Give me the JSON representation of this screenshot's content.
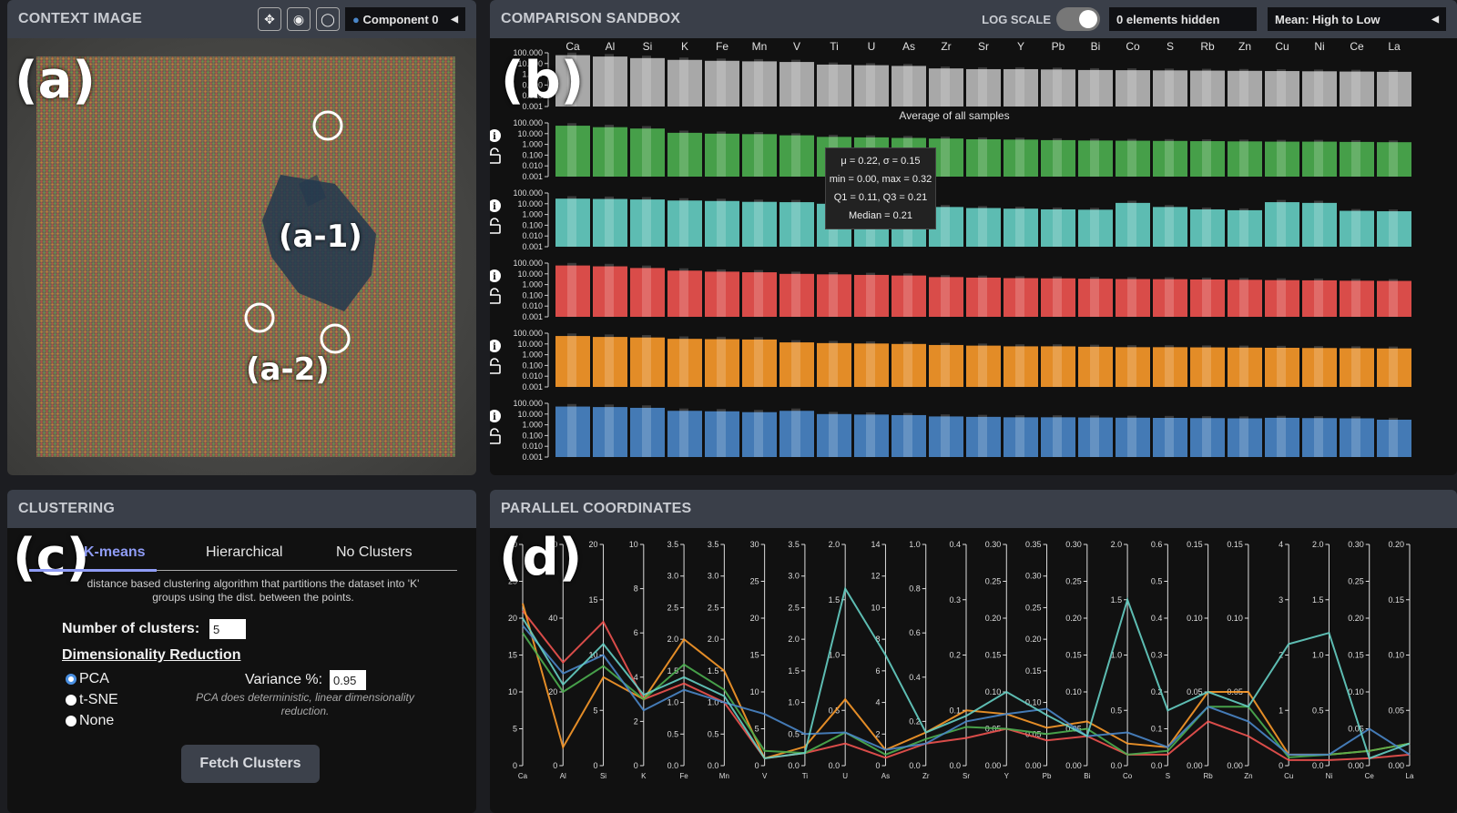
{
  "panel_labels": {
    "a": "(a)",
    "a1": "(a-1)",
    "a2": "(a-2)",
    "b": "(b)",
    "c": "(c)",
    "d": "(d)"
  },
  "context": {
    "title": "CONTEXT IMAGE",
    "buttons": [
      {
        "icon": "lasso-move-icon"
      },
      {
        "icon": "eye-icon"
      },
      {
        "icon": "lasso-icon"
      }
    ],
    "component_select": "Component 0"
  },
  "sandbox": {
    "title": "COMPARISON SANDBOX",
    "log_scale_label": "LOG SCALE",
    "hidden_text": "0 elements hidden",
    "sort_select": "Mean: High to Low",
    "elements": [
      "Ca",
      "Al",
      "Si",
      "K",
      "Fe",
      "Mn",
      "V",
      "Ti",
      "U",
      "As",
      "Zr",
      "Sr",
      "Y",
      "Pb",
      "Bi",
      "Co",
      "S",
      "Rb",
      "Zn",
      "Cu",
      "Ni",
      "Ce",
      "La"
    ],
    "y_ticks": [
      "100.000",
      "10.000",
      "1.000",
      "0.100",
      "0.010",
      "0.001"
    ],
    "average_caption": "Average of all samples",
    "tooltip": [
      "μ = 0.22, σ = 0.15",
      "min = 0.00, max = 0.32",
      "Q1 = 0.11, Q3 = 0.21",
      "Median = 0.21"
    ],
    "rows": [
      {
        "color": "#b9b9b9",
        "values": [
          60,
          45,
          32,
          22,
          18,
          16,
          14,
          8,
          7,
          6,
          3.5,
          3,
          3,
          2.8,
          2.5,
          2.4,
          2.3,
          2.2,
          2.1,
          2,
          1.9,
          1.8,
          1.7
        ]
      },
      {
        "color": "#4caf50",
        "values": [
          55,
          40,
          30,
          12,
          10,
          9,
          7,
          5,
          4.5,
          4,
          3.5,
          3,
          2.8,
          2.5,
          2.3,
          2.2,
          2.1,
          2,
          1.9,
          1.8,
          1.8,
          1.7,
          1.6
        ]
      },
      {
        "color": "#66cfc4",
        "values": [
          30,
          28,
          25,
          20,
          18,
          15,
          14,
          10,
          9,
          8,
          5,
          4,
          3.5,
          3,
          2.8,
          12,
          5,
          3,
          2.5,
          14,
          12,
          2.2,
          2
        ]
      },
      {
        "color": "#ef5350",
        "values": [
          60,
          50,
          35,
          20,
          16,
          14,
          10,
          9,
          8,
          7,
          5,
          4.5,
          4,
          3.8,
          3.5,
          3.3,
          3.2,
          3,
          2.8,
          2.6,
          2.5,
          2.3,
          2.2
        ]
      },
      {
        "color": "#fb9a2a",
        "values": [
          55,
          45,
          40,
          30,
          28,
          26,
          14,
          12,
          11,
          10,
          8,
          7,
          6,
          6,
          5.5,
          5,
          5,
          4.8,
          4.6,
          4.4,
          4.2,
          4,
          3.8
        ]
      },
      {
        "color": "#4a86c8",
        "values": [
          50,
          45,
          38,
          20,
          18,
          15,
          20,
          10,
          9,
          8,
          6,
          5.5,
          5,
          5,
          4.8,
          4.6,
          4.4,
          4.2,
          4,
          4.5,
          4.2,
          4,
          3
        ]
      }
    ]
  },
  "clustering": {
    "title": "CLUSTERING",
    "tabs": [
      "K-means",
      "Hierarchical",
      "No Clusters"
    ],
    "description": "distance based clustering algorithm that partitions the dataset into 'K' groups using the dist. between the points.",
    "num_clusters_label": "Number of clusters:",
    "num_clusters_value": "5",
    "dim_reduction_label": "Dimensionality Reduction",
    "options": [
      "PCA",
      "t-SNE",
      "None"
    ],
    "variance_label": "Variance %:",
    "variance_value": "0.95",
    "pca_note": "PCA does deterministic, linear dimensionality reduction.",
    "fetch_button": "Fetch Clusters"
  },
  "parallel": {
    "title": "PARALLEL COORDINATES",
    "axes": [
      {
        "name": "Ca",
        "ticks": [
          "30",
          "25",
          "20",
          "15",
          "10",
          "5",
          "0"
        ],
        "max": 30
      },
      {
        "name": "Al",
        "ticks": [
          "60",
          "40",
          "20",
          "0"
        ],
        "max": 60
      },
      {
        "name": "Si",
        "ticks": [
          "20",
          "15",
          "10",
          "5",
          "0"
        ],
        "max": 20
      },
      {
        "name": "K",
        "ticks": [
          "10",
          "8",
          "6",
          "4",
          "2",
          "0"
        ],
        "max": 10
      },
      {
        "name": "Fe",
        "ticks": [
          "3.5",
          "3.0",
          "2.5",
          "2.0",
          "1.5",
          "1.0",
          "0.5",
          "0.0"
        ],
        "max": 3.5
      },
      {
        "name": "Mn",
        "ticks": [
          "3.5",
          "3.0",
          "2.5",
          "2.0",
          "1.5",
          "1.0",
          "0.5",
          "0.0"
        ],
        "max": 3.5
      },
      {
        "name": "V",
        "ticks": [
          "30",
          "25",
          "20",
          "15",
          "10",
          "5",
          "0"
        ],
        "max": 30
      },
      {
        "name": "Ti",
        "ticks": [
          "3.5",
          "3.0",
          "2.5",
          "2.0",
          "1.5",
          "1.0",
          "0.5",
          "0.0"
        ],
        "max": 3.5
      },
      {
        "name": "U",
        "ticks": [
          "2.0",
          "1.5",
          "1.0",
          "0.5",
          "0.0"
        ],
        "max": 2.0
      },
      {
        "name": "As",
        "ticks": [
          "14",
          "12",
          "10",
          "8",
          "6",
          "4",
          "2",
          "0"
        ],
        "max": 14
      },
      {
        "name": "Zr",
        "ticks": [
          "1.0",
          "0.8",
          "0.6",
          "0.4",
          "0.2",
          "0.0"
        ],
        "max": 1.0
      },
      {
        "name": "Sr",
        "ticks": [
          "0.4",
          "0.3",
          "0.2",
          "0.1",
          "0.0"
        ],
        "max": 0.4
      },
      {
        "name": "Y",
        "ticks": [
          "0.30",
          "0.25",
          "0.20",
          "0.15",
          "0.10",
          "0.05",
          "0.00"
        ],
        "max": 0.3
      },
      {
        "name": "Pb",
        "ticks": [
          "0.35",
          "0.30",
          "0.25",
          "0.20",
          "0.15",
          "0.10",
          "0.05",
          "0.00"
        ],
        "max": 0.35
      },
      {
        "name": "Bi",
        "ticks": [
          "0.30",
          "0.25",
          "0.20",
          "0.15",
          "0.10",
          "0.05",
          "0.00"
        ],
        "max": 0.3
      },
      {
        "name": "Co",
        "ticks": [
          "2.0",
          "1.5",
          "1.0",
          "0.5",
          "0.0"
        ],
        "max": 2.0
      },
      {
        "name": "S",
        "ticks": [
          "0.6",
          "0.5",
          "0.4",
          "0.3",
          "0.2",
          "0.1",
          "0.0"
        ],
        "max": 0.6
      },
      {
        "name": "Rb",
        "ticks": [
          "0.15",
          "0.10",
          "0.05",
          "0.00"
        ],
        "max": 0.15
      },
      {
        "name": "Zn",
        "ticks": [
          "0.15",
          "0.10",
          "0.05",
          "0.00"
        ],
        "max": 0.15
      },
      {
        "name": "Cu",
        "ticks": [
          "4",
          "3",
          "2",
          "1",
          "0"
        ],
        "max": 4
      },
      {
        "name": "Ni",
        "ticks": [
          "2.0",
          "1.5",
          "1.0",
          "0.5",
          "0.0"
        ],
        "max": 2.0
      },
      {
        "name": "Ce",
        "ticks": [
          "0.30",
          "0.25",
          "0.20",
          "0.15",
          "0.10",
          "0.05",
          "0.00"
        ],
        "max": 0.3
      },
      {
        "name": "La",
        "ticks": [
          "0.20",
          "0.15",
          "0.10",
          "0.05",
          "0.00"
        ],
        "max": 0.2
      }
    ],
    "lines": [
      {
        "color": "#ef5350",
        "values": [
          21,
          28,
          13,
          3,
          1.3,
          1.0,
          1,
          0.2,
          0.2,
          0.5,
          0.1,
          0.05,
          0.05,
          0.04,
          0.04,
          0.1,
          0.03,
          0.03,
          0.02,
          0.1,
          0.05,
          0.01,
          0.01
        ]
      },
      {
        "color": "#fb9a2a",
        "values": [
          22,
          5,
          8,
          3,
          2.0,
          1.5,
          1,
          0.3,
          0.6,
          1.0,
          0.15,
          0.1,
          0.07,
          0.06,
          0.06,
          0.2,
          0.05,
          0.05,
          0.05,
          0.2,
          0.1,
          0.02,
          0.02
        ]
      },
      {
        "color": "#4caf50",
        "values": [
          18,
          20,
          9,
          3,
          1.6,
          1.2,
          2,
          0.2,
          0.3,
          0.7,
          0.12,
          0.07,
          0.05,
          0.05,
          0.05,
          0.1,
          0.04,
          0.04,
          0.04,
          0.15,
          0.1,
          0.02,
          0.02
        ]
      },
      {
        "color": "#4a86c8",
        "values": [
          19,
          25,
          10,
          2.5,
          1.2,
          1.0,
          7,
          0.5,
          0.3,
          1.0,
          0.1,
          0.08,
          0.07,
          0.09,
          0.04,
          0.3,
          0.05,
          0.04,
          0.03,
          0.2,
          0.1,
          0.05,
          0.01
        ]
      },
      {
        "color": "#66cfc4",
        "values": [
          20,
          22,
          11,
          3.2,
          1.4,
          1.1,
          1,
          0.2,
          1.6,
          7,
          0.15,
          0.09,
          0.1,
          0.08,
          0.04,
          1.5,
          0.15,
          0.05,
          0.04,
          2.2,
          1.2,
          0.01,
          0.02
        ]
      }
    ]
  }
}
